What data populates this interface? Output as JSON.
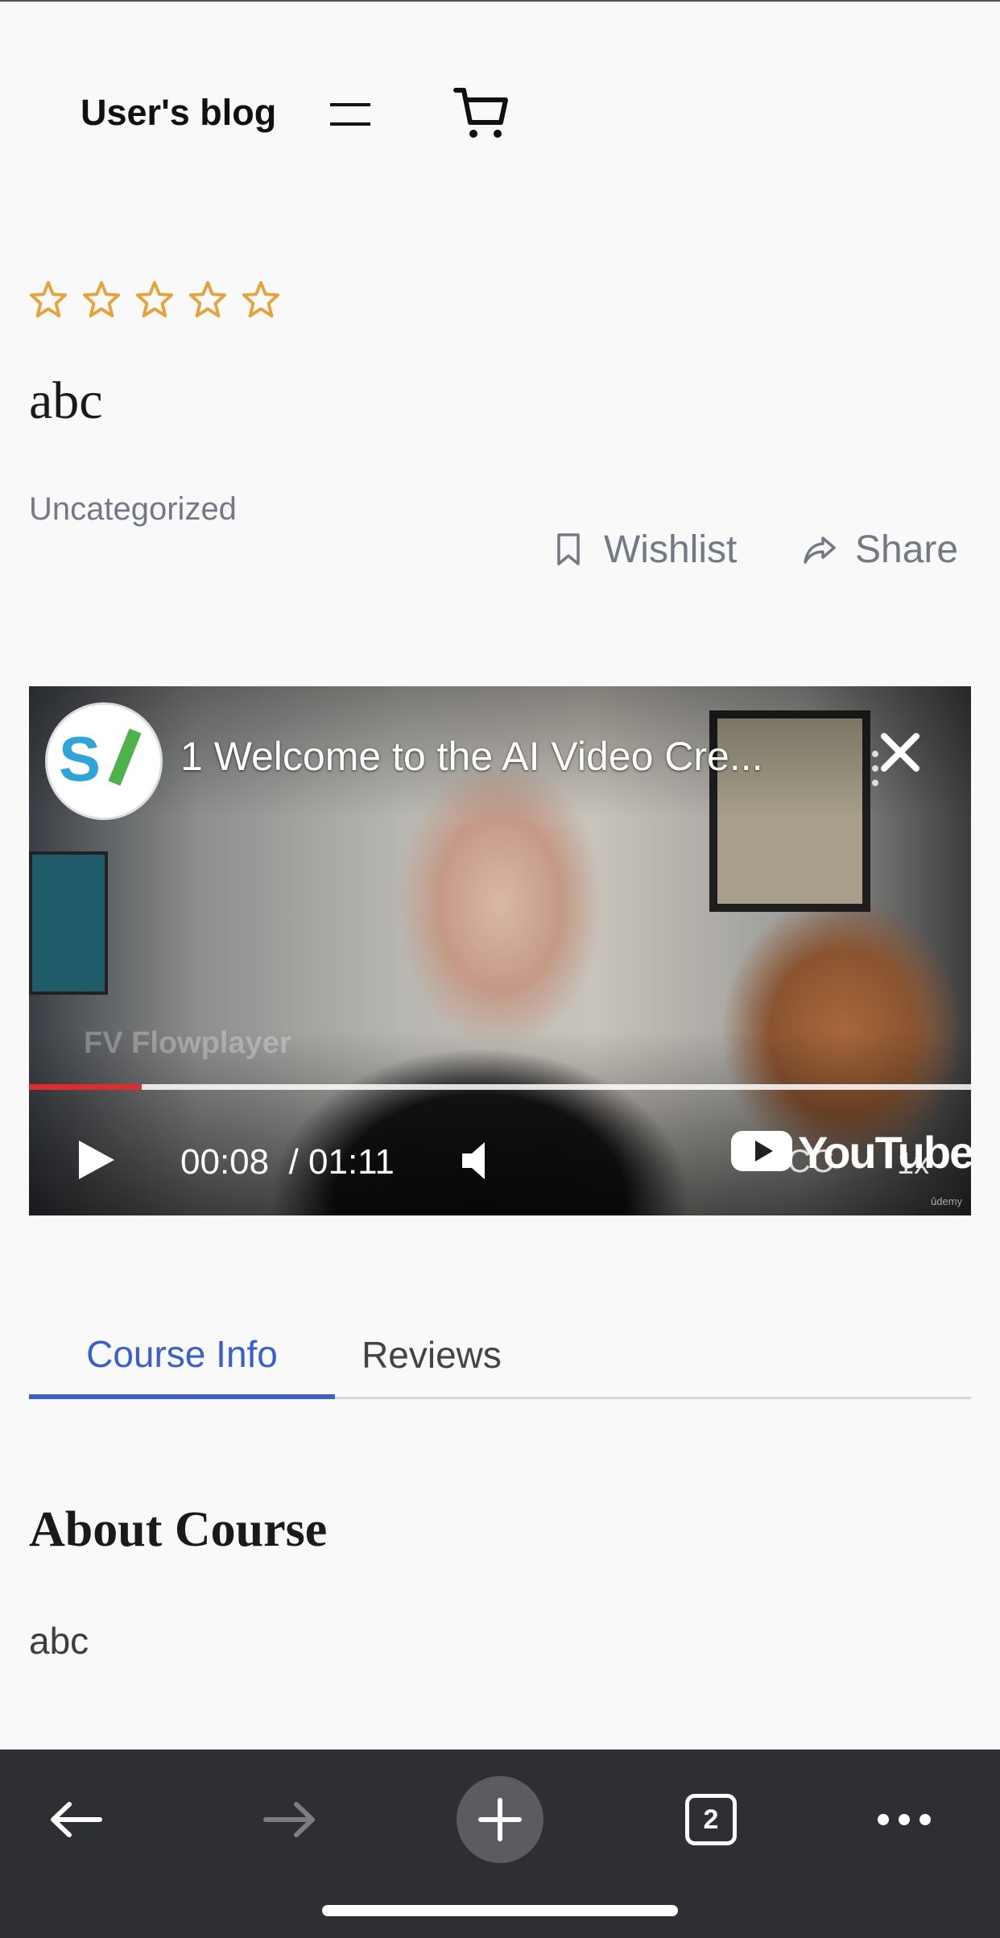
{
  "header": {
    "site_title": "User's blog"
  },
  "course": {
    "rating": {
      "value": 0,
      "max": 5
    },
    "title": "abc",
    "category": "Uncategorized",
    "wishlist_label": "Wishlist",
    "share_label": "Share"
  },
  "video": {
    "title": "1 Welcome to the AI Video Cre...",
    "watermark": "FV Flowplayer",
    "current_time": "00:08",
    "duration": "/ 01:11",
    "progress_fraction": 0.12,
    "youtube_label": "YouTube",
    "cc_label": "CC",
    "speed_label": "1x",
    "corner_brand": "ûdemy"
  },
  "tabs": [
    {
      "label": "Course Info",
      "active": true
    },
    {
      "label": "Reviews",
      "active": false
    }
  ],
  "about": {
    "heading": "About Course",
    "text": "abc"
  },
  "browser_toolbar": {
    "tab_count": "2"
  },
  "colors": {
    "accent": "#3a5fcd",
    "star": "#e8a23a",
    "toolbar_bg": "#2e2f33",
    "progress": "#e02c2c"
  }
}
